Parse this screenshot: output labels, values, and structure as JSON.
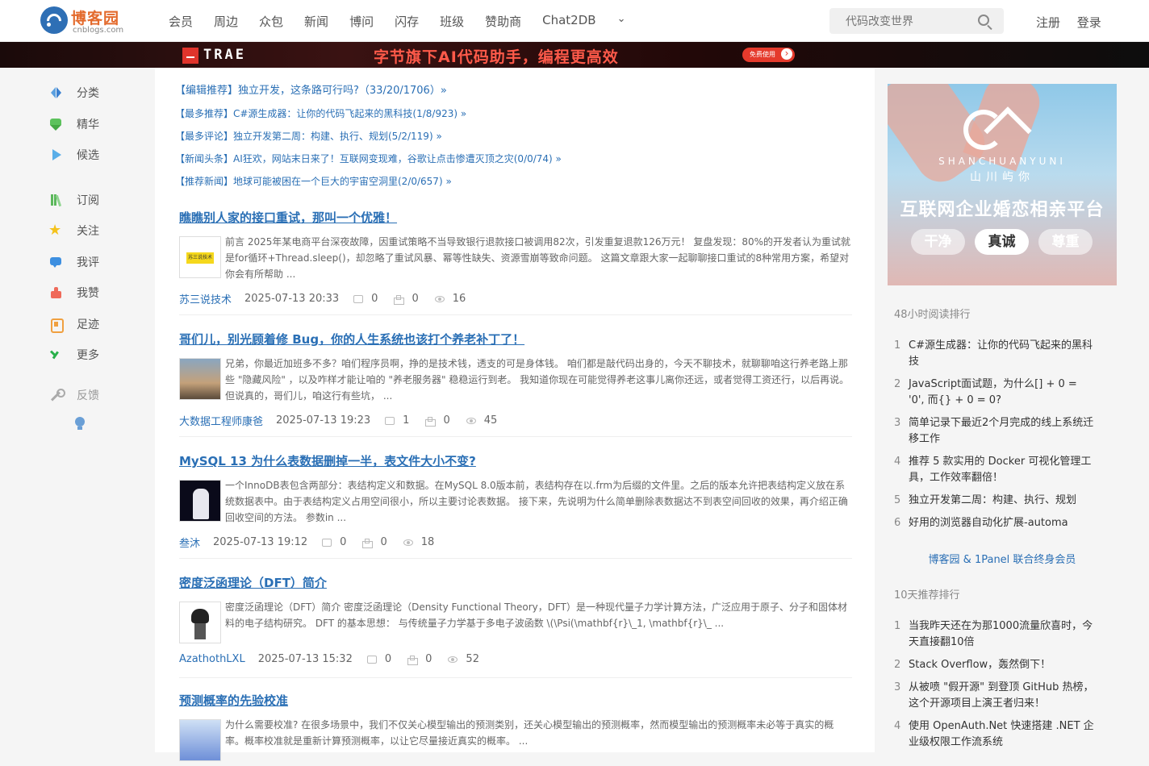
{
  "header": {
    "logo_text": "博客园",
    "logo_sub": "cnblogs.com",
    "nav": [
      "会员",
      "周边",
      "众包",
      "新闻",
      "博问",
      "闪存",
      "班级",
      "赞助商",
      "Chat2DB"
    ],
    "search_placeholder": "代码改变世界",
    "register": "注册",
    "login": "登录"
  },
  "banner": {
    "brand": "TRAE",
    "slogan": "字节旗下AI代码助手，编程更高效",
    "cta": "免费使用"
  },
  "sidebar": {
    "items": [
      {
        "label": "分类",
        "icon": "category-icon"
      },
      {
        "label": "精华",
        "icon": "gem-icon"
      },
      {
        "label": "候选",
        "icon": "play-icon"
      },
      {
        "label": "订阅",
        "icon": "subscribe-icon"
      },
      {
        "label": "关注",
        "icon": "star-icon"
      },
      {
        "label": "我评",
        "icon": "comment-icon"
      },
      {
        "label": "我赞",
        "icon": "like-icon"
      },
      {
        "label": "足迹",
        "icon": "footprint-icon"
      },
      {
        "label": "更多",
        "icon": "check-icon"
      }
    ],
    "feedback": "反馈"
  },
  "recommendations": [
    "【编辑推荐】独立开发，这条路可行吗?（33/20/1706）»",
    "【最多推荐】C#源生成器：让你的代码飞起来的黑科技(1/8/923) »",
    "【最多评论】独立开发第二周：构建、执行、规划(5/2/119) »",
    "【新闻头条】AI狂欢，网站末日来了！互联网变现难，谷歌让点击惨遭灭顶之灾(0/0/74) »",
    "【推荐新闻】地球可能被困在一个巨大的宇宙空洞里(2/0/657) »"
  ],
  "posts": [
    {
      "title": "瞧瞧别人家的接口重试，那叫一个优雅！",
      "avatar_text": "苏三说技术",
      "summary": "前言 2025年某电商平台深夜故障，因重试策略不当导致银行退款接口被调用82次，引发重复退款126万元！ 复盘发现：80%的开发者认为重试就是for循环+Thread.sleep()，却忽略了重试风暴、幂等性缺失、资源雪崩等致命问题。 这篇文章跟大家一起聊聊接口重试的8种常用方案，希望对你会有所帮助 ...",
      "author": "苏三说技术",
      "date": "2025-07-13 20:33",
      "comments": "0",
      "likes": "0",
      "views": "16"
    },
    {
      "title": "哥们儿，别光顾着修 Bug，你的人生系统也该打个养老补丁了！",
      "summary": "兄弟，你最近加班多不多？咱们程序员啊，挣的是技术钱，透支的可是身体钱。 咱们都是敲代码出身的，今天不聊技术，就聊聊咱这行养老路上那些 \"隐藏风险\" ，以及咋样才能让咱的 \"养老服务器\" 稳稳运行到老。 我知道你现在可能觉得养老这事儿离你还远，或者觉得工资还行，以后再说。 但说真的，哥们儿，咱这行有些坑， ...",
      "author": "大数据工程师康爸",
      "date": "2025-07-13 19:23",
      "comments": "1",
      "likes": "0",
      "views": "45"
    },
    {
      "title": "MySQL 13 为什么表数据删掉一半，表文件大小不变?",
      "summary": "一个InnoDB表包含两部分：表结构定义和数据。在MySQL 8.0版本前，表结构存在以.frm为后缀的文件里。之后的版本允许把表结构定义放在系统数据表中。由于表结构定义占用空间很小，所以主要讨论表数据。 接下来，先说明为什么简单删除表数据达不到表空间回收的效果，再介绍正确回收空间的方法。 参数in ...",
      "author": "叁沐",
      "date": "2025-07-13 19:12",
      "comments": "0",
      "likes": "0",
      "views": "18"
    },
    {
      "title": "密度泛函理论（DFT）简介",
      "summary": "密度泛函理论（DFT）简介 密度泛函理论（Density Functional Theory，DFT）是一种现代量子力学计算方法，广泛应用于原子、分子和固体材料的电子结构研究。 DFT 的基本思想： 与传统量子力学基于多电子波函数 \\(\\Psi(\\mathbf{r}\\_1, \\mathbf{r}\\_ ...",
      "author": "AzathothLXL",
      "date": "2025-07-13 15:32",
      "comments": "0",
      "likes": "0",
      "views": "52"
    },
    {
      "title": "预测概率的先验校准",
      "summary": "为什么需要校准? 在很多场景中，我们不仅关心模型输出的预测类别，还关心模型输出的预测概率，然而模型输出的预测概率未必等于真实的概率。概率校准就是重新计算预测概率，以让它尽量接近真实的概率。 ..."
    }
  ],
  "right": {
    "ad": {
      "brand_en": "SHANCHUANYUNI",
      "brand_cn": "山川屿你",
      "title": "互联网企业婚恋相亲平台",
      "tags": [
        "干净",
        "真诚",
        "尊重"
      ]
    },
    "rank48_title": "48小时阅读排行",
    "rank48": [
      "C#源生成器：让你的代码飞起来的黑科技",
      "JavaScript面试题，为什么[] + 0 = '0', 而{} + 0 = 0?",
      "简单记录下最近2个月完成的线上系统迁移工作",
      "推荐 5 款实用的 Docker 可视化管理工具，工作效率翻倍！",
      "独立开发第二周：构建、执行、规划",
      "好用的浏览器自动化扩展-automa"
    ],
    "partner": "博客园 & 1Panel 联合终身会员",
    "rank10_title": "10天推荐排行",
    "rank10": [
      "当我昨天还在为那1000流量欣喜时，今天直接翻10倍",
      "Stack Overflow，轰然倒下！",
      "从被喷 \"假开源\" 到登顶 GitHub 热榜，这个开源项目上演王者归来！",
      "使用 OpenAuth.Net 快速搭建 .NET 企业级权限工作流系统"
    ]
  }
}
